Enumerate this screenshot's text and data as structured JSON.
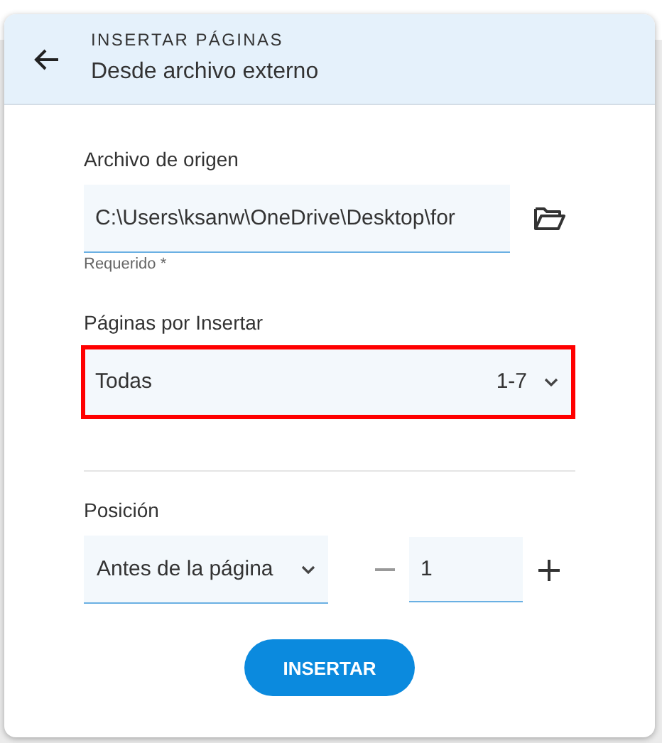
{
  "header": {
    "overline": "INSERTAR PÁGINAS",
    "title": "Desde archivo externo"
  },
  "source": {
    "label": "Archivo de origen",
    "value": "C:\\Users\\ksanw\\OneDrive\\Desktop\\for",
    "hint": "Requerido *"
  },
  "pages": {
    "label": "Páginas por Insertar",
    "value": "Todas",
    "range": "1-7",
    "highlighted": true
  },
  "position": {
    "label": "Posición",
    "mode": "Antes de la página",
    "page": "1"
  },
  "buttons": [
    "INSERTAR"
  ]
}
